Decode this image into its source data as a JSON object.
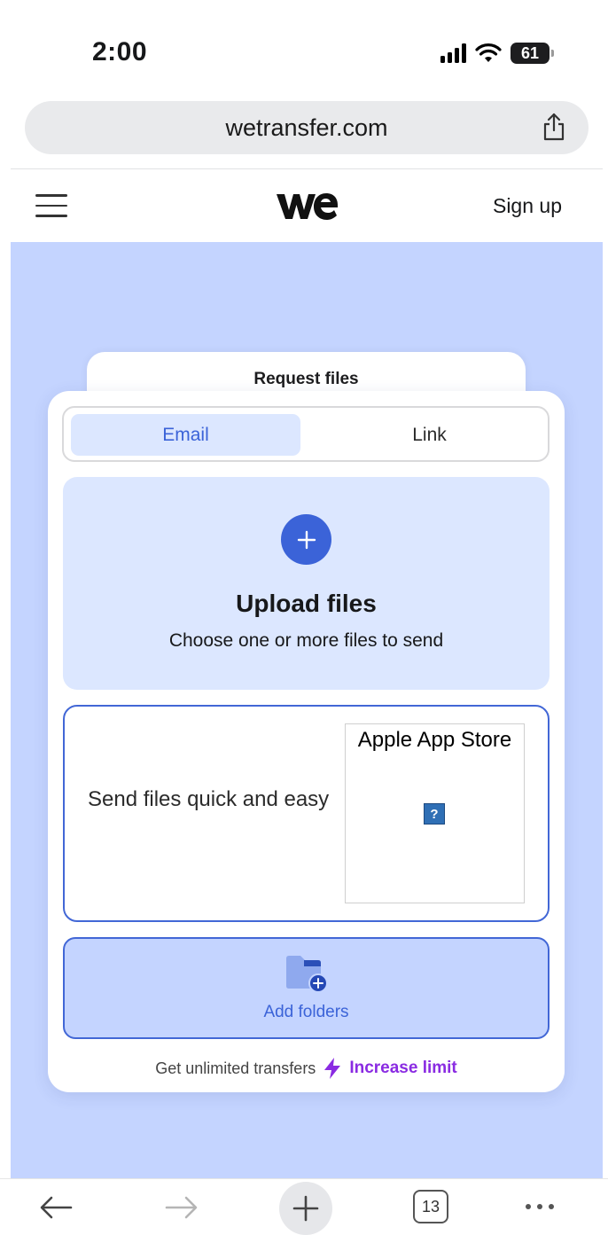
{
  "status_bar": {
    "time": "2:00",
    "battery_level": "61"
  },
  "browser": {
    "url": "wetransfer.com",
    "open_tabs": "13"
  },
  "site_header": {
    "signup_label": "Sign up"
  },
  "transfer_panel": {
    "request_tab_label": "Request files",
    "tabs": [
      {
        "label": "Email",
        "selected": true
      },
      {
        "label": "Link",
        "selected": false
      }
    ],
    "upload": {
      "title": "Upload files",
      "subtitle": "Choose one or more files to send"
    },
    "promo": {
      "text": "Send files quick and easy",
      "store_badge_alt": "Apple App Store",
      "broken_image_glyph": "?"
    },
    "add_folders_label": "Add folders",
    "limit": {
      "text": "Get unlimited transfers",
      "link": "Increase limit"
    }
  },
  "colors": {
    "hero_background": "#c4d4ff",
    "accent_blue": "#3b63d8",
    "selected_tab_background": "#dce7ff",
    "promo_border": "#4267d6",
    "increase_limit": "#8a2be2"
  },
  "icons": {
    "signal": "cellular-signal-icon",
    "wifi": "wifi-icon",
    "share": "share-icon",
    "menu": "hamburger-menu-icon",
    "logo": "wetransfer-we-logo",
    "upload": "plus-circle-icon",
    "folder": "folder-add-icon",
    "bolt": "lightning-bolt-icon",
    "back": "arrow-left-icon",
    "forward": "arrow-right-icon",
    "new_tab": "plus-icon",
    "more": "more-dots-icon"
  }
}
